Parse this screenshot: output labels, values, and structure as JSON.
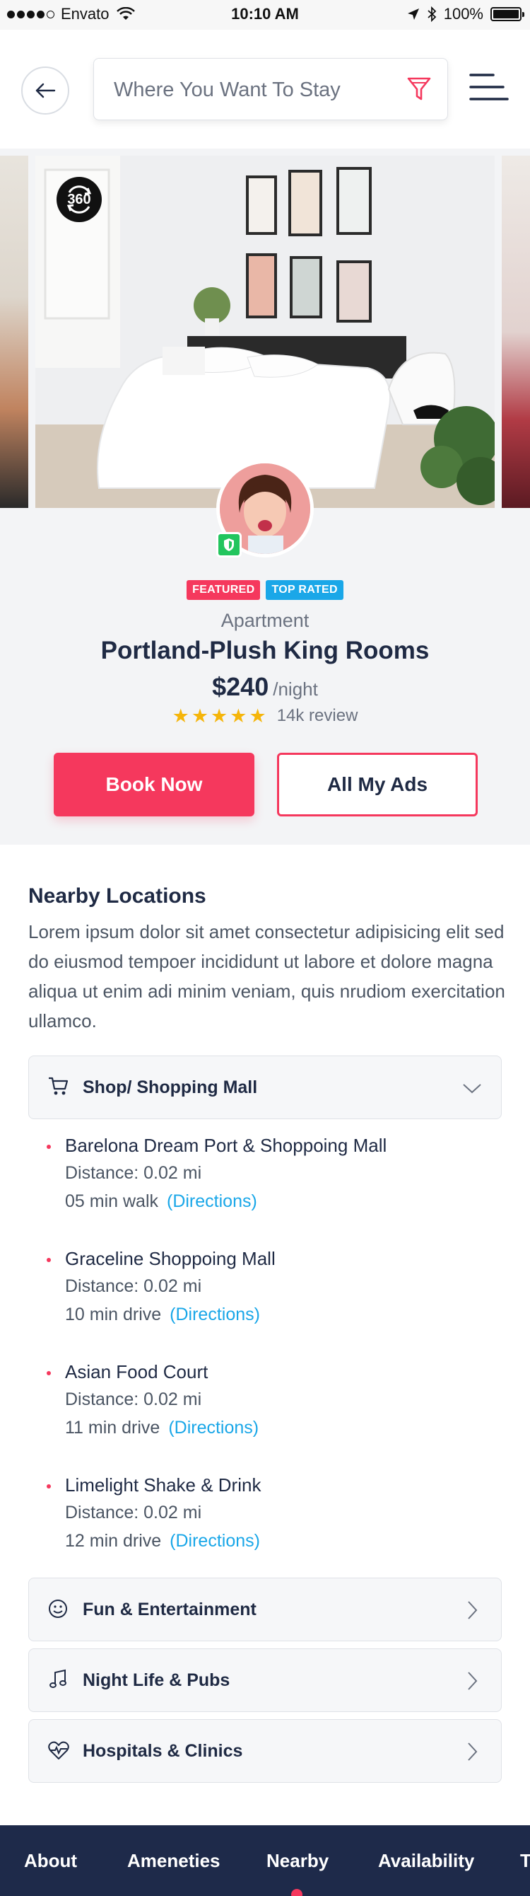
{
  "status_bar": {
    "carrier": "Envato",
    "time": "10:10 AM",
    "battery": "100%"
  },
  "header": {
    "search_placeholder": "Where You Want To Stay",
    "icons": [
      "back-arrow-icon",
      "filter-icon",
      "menu-icon"
    ]
  },
  "gallery": {
    "badge_360": "360"
  },
  "listing": {
    "tags": [
      "FEATURED",
      "TOP RATED"
    ],
    "type": "Apartment",
    "title": "Portland-Plush King Rooms",
    "price": "$240",
    "price_unit": "/night",
    "rating_stars": 5,
    "reviews": "14k review",
    "book_label": "Book Now",
    "ads_label": "All My Ads"
  },
  "nearby": {
    "title": "Nearby Locations",
    "description": "Lorem ipsum dolor sit amet consectetur adipisicing elit sed do eiusmod tempoer incididunt ut labore et dolore magna aliqua ut enim adi minim veniam, quis nrudiom exercitation ullamco.",
    "categories": [
      {
        "label": "Shop/ Shopping Mall",
        "icon": "shopping-cart-icon",
        "expanded": true,
        "places": [
          {
            "name": "Barelona Dream Port & Shoppoing Mall",
            "distance": "Distance: 0.02 mi",
            "time": "05 min walk",
            "link": "(Directions)"
          },
          {
            "name": "Graceline Shoppoing Mall",
            "distance": "Distance: 0.02 mi",
            "time": "10 min drive",
            "link": "(Directions)"
          },
          {
            "name": "Asian Food Court",
            "distance": "Distance: 0.02 mi",
            "time": "11 min drive",
            "link": "(Directions)"
          },
          {
            "name": "Limelight Shake & Drink",
            "distance": "Distance: 0.02 mi",
            "time": "12 min drive",
            "link": "(Directions)"
          }
        ]
      },
      {
        "label": "Fun & Entertainment",
        "icon": "smiley-icon",
        "expanded": false
      },
      {
        "label": "Night Life & Pubs",
        "icon": "music-note-icon",
        "expanded": false
      },
      {
        "label": "Hospitals & Clinics",
        "icon": "heart-pulse-icon",
        "expanded": false
      }
    ]
  },
  "tabs": {
    "items": [
      "About",
      "Ameneties",
      "Nearby",
      "Availability",
      "T"
    ],
    "active": "Nearby"
  },
  "colors": {
    "accent": "#f5385d",
    "navy": "#1e2a4a",
    "link": "#1aa7e8",
    "star": "#f5b50a"
  }
}
